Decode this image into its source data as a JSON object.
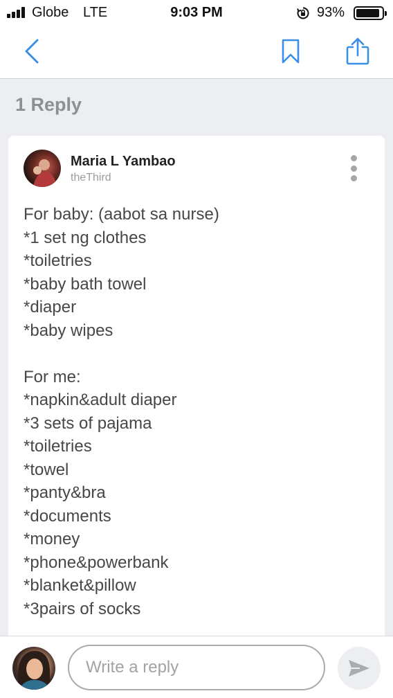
{
  "status_bar": {
    "carrier": "Globe",
    "network": "LTE",
    "time": "9:03 PM",
    "battery_percent": "93%",
    "battery_level": 0.93,
    "icons": [
      "signal-icon",
      "rotation-lock-icon",
      "battery-icon"
    ]
  },
  "nav": {
    "icons": [
      "back-chevron-icon",
      "bookmark-icon",
      "share-icon"
    ],
    "accent_color": "#3a8ee6"
  },
  "thread": {
    "reply_count_label": "1 Reply"
  },
  "reply": {
    "author": "Maria L Yambao",
    "handle": "theThird",
    "body_lines": [
      "For baby: (aabot sa nurse)",
      "*1 set ng clothes",
      "*toiletries",
      "*baby bath towel",
      "*diaper",
      "*baby wipes",
      "",
      "For me:",
      "*napkin&adult diaper",
      "*3 sets of pajama",
      "*toiletries",
      "*towel",
      "*panty&bra",
      "*documents",
      "*money",
      "*phone&powerbank",
      "*blanket&pillow",
      "*3pairs of socks"
    ]
  },
  "composer": {
    "placeholder": "Write a reply",
    "value": ""
  }
}
